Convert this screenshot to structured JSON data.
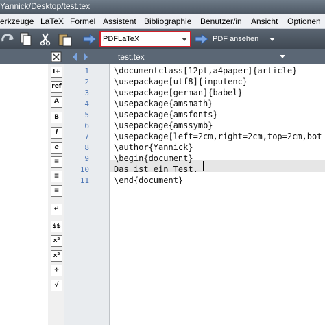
{
  "window": {
    "title": "Yannick/Desktop/test.tex"
  },
  "menu": [
    "erkzeuge",
    "LaTeX",
    "Formel",
    "Assistent",
    "Bibliographie",
    "Benutzer/in",
    "Ansicht",
    "Optionen"
  ],
  "toolbar": {
    "engine_value": "PDFLaTeX",
    "view_label": "PDF ansehen"
  },
  "tab": {
    "label": "test.tex"
  },
  "sidebar": {
    "buttons": [
      "I+",
      "ref",
      "A",
      "B",
      "i",
      "e",
      "≡",
      "≡",
      "≡",
      "↵",
      "$$",
      "x²",
      "x²",
      "÷",
      "√"
    ]
  },
  "editor": {
    "line_numbers": [
      "1",
      "2",
      "3",
      "4",
      "5",
      "6",
      "7",
      "8",
      "9",
      "10",
      "11"
    ],
    "lines": [
      "\\documentclass[12pt,a4paper]{article}",
      "\\usepackage[utf8]{inputenc}",
      "\\usepackage[german]{babel}",
      "\\usepackage{amsmath}",
      "\\usepackage{amsfonts}",
      "\\usepackage{amssymb}",
      "\\usepackage[left=2cm,right=2cm,top=2cm,bot",
      "\\author{Yannick}",
      "\\begin{document}",
      "Das ist ein Test.",
      "\\end{document}"
    ]
  }
}
